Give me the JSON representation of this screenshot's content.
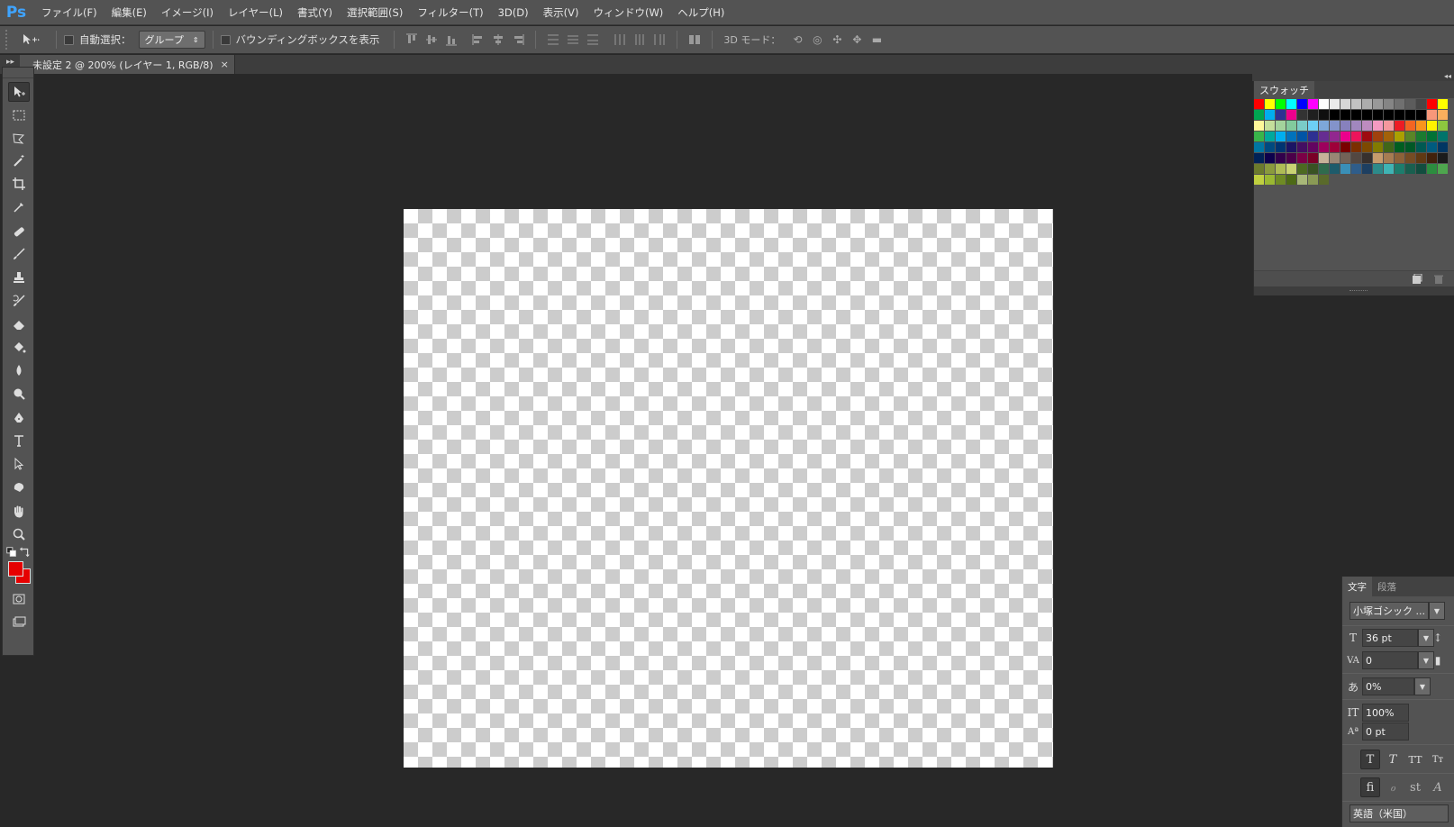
{
  "app": {
    "logo": "Ps"
  },
  "menu": [
    "ファイル(F)",
    "編集(E)",
    "イメージ(I)",
    "レイヤー(L)",
    "書式(Y)",
    "選択範囲(S)",
    "フィルター(T)",
    "3D(D)",
    "表示(V)",
    "ウィンドウ(W)",
    "ヘルプ(H)"
  ],
  "options": {
    "auto_select_label": "自動選択：",
    "auto_select_value": "グループ",
    "bounding_box_label": "バウンディングボックスを表示",
    "mode3d_label": "3D モード："
  },
  "document": {
    "tab_title": "未設定 2 @ 200% (レイヤー 1, RGB/8)",
    "close_glyph": "×"
  },
  "colors": {
    "foreground": "#e60000",
    "background": "#e60000"
  },
  "swatches": {
    "tab_label": "スウォッチ",
    "rows": [
      [
        "#ff0000",
        "#ffff00",
        "#00ff00",
        "#00ffff",
        "#0000ff",
        "#ff00ff",
        "#ffffff",
        "#ebebeb",
        "#d6d6d6",
        "#c2c2c2",
        "#adadad",
        "#999999",
        "#858585",
        "#707070",
        "#5c5c5c",
        "#474747",
        "#ff0000",
        "#ffff00"
      ],
      [
        "#00a651",
        "#00aeef",
        "#2e3192",
        "#ec008c",
        "#333333",
        "#1f1f1f",
        "#0f0f0f",
        "#000000",
        "#000000",
        "#000000",
        "#000000",
        "#000000",
        "#000000",
        "#000000",
        "#000000",
        "#000000",
        "#f7977a",
        "#fbaf5d"
      ],
      [
        "#fff79a",
        "#c4df9b",
        "#a3d39c",
        "#82ca9d",
        "#7accc8",
        "#6dcff6",
        "#7da7d9",
        "#8393ca",
        "#8781bd",
        "#a187be",
        "#bd8cbf",
        "#f49ac1",
        "#f5989d",
        "#ed1c24",
        "#f26522",
        "#f7941d",
        "#fff200",
        "#8dc63f"
      ],
      [
        "#39b54a",
        "#00a99d",
        "#00aeef",
        "#0072bc",
        "#0054a6",
        "#2e3192",
        "#662d91",
        "#92278f",
        "#ec008c",
        "#ed145b",
        "#9e0b0f",
        "#a0410d",
        "#a36209",
        "#aba000",
        "#598527",
        "#1a7b30",
        "#007236",
        "#00746b"
      ],
      [
        "#0076a3",
        "#004a80",
        "#003471",
        "#1b1464",
        "#440e62",
        "#630460",
        "#9e005d",
        "#9e0039",
        "#790000",
        "#7b2e00",
        "#7d4900",
        "#827b00",
        "#406618",
        "#005e20",
        "#005826",
        "#005952",
        "#005b7f",
        "#003663"
      ],
      [
        "#002157",
        "#0d004c",
        "#32004b",
        "#4b0049",
        "#7b0046",
        "#7a0026",
        "#c7b299",
        "#998675",
        "#736357",
        "#534741",
        "#37302d",
        "#c69c6d",
        "#a67c52",
        "#8c6239",
        "#754c24",
        "#603913",
        "#42210b",
        "#1b1b1b"
      ],
      [
        "#6b7a2d",
        "#8a9a3d",
        "#aebc55",
        "#c9d373",
        "#4c6a21",
        "#395323",
        "#2f6b4d",
        "#1e5b6b",
        "#3a8fb7",
        "#2f5d8a",
        "#1d3f61",
        "#2d8a8a",
        "#3fb4b4",
        "#1d7d6d",
        "#195f4f",
        "#124d3f",
        "#2c8d3f",
        "#4ea64e"
      ],
      [
        "#c0d040",
        "#9ab832",
        "#6f8b24",
        "#4d6a16",
        "#a8b878",
        "#8a9a55",
        "#5a6a2b"
      ]
    ]
  },
  "character": {
    "tab_character": "文字",
    "tab_paragraph": "段落",
    "font_family": "小塚ゴシック ...",
    "font_size": "36 pt",
    "kerning": "0",
    "tsume": "0%",
    "vertical_scale": "100%",
    "baseline_shift": "0 pt",
    "language": "英語（米国）"
  }
}
